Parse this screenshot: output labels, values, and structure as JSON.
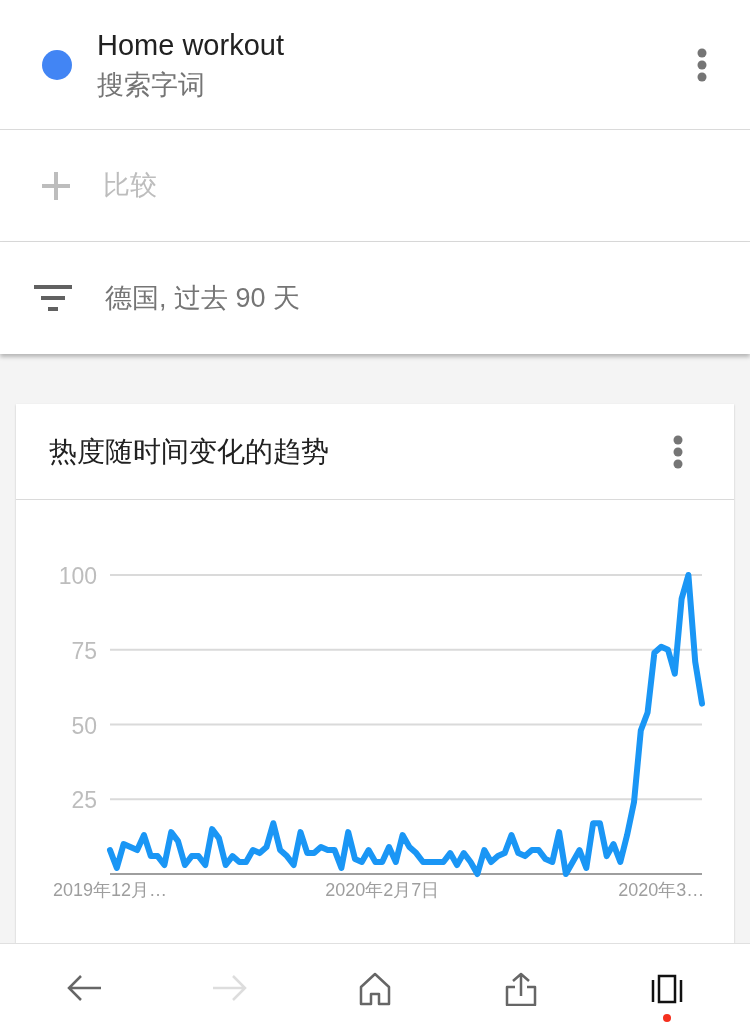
{
  "search_term": {
    "name": "Home workout",
    "subtitle": "搜索字词",
    "color": "#4285f4"
  },
  "compare": {
    "label": "比较"
  },
  "filter": {
    "label": "德国, 过去 90 天"
  },
  "card": {
    "title": "热度随时间变化的趋势",
    "chart_data": {
      "type": "line",
      "grid": true,
      "ylim": [
        0,
        100
      ],
      "yticks": [
        25,
        50,
        75,
        100
      ],
      "categories": [
        "2019年12月…",
        null,
        null,
        null,
        null,
        null,
        null,
        null,
        null,
        null,
        null,
        null,
        null,
        null,
        null,
        null,
        null,
        null,
        null,
        null,
        null,
        null,
        null,
        null,
        null,
        null,
        null,
        null,
        null,
        null,
        null,
        null,
        null,
        null,
        null,
        null,
        null,
        null,
        null,
        null,
        "2020年2月7日",
        null,
        null,
        null,
        null,
        null,
        null,
        null,
        null,
        null,
        null,
        null,
        null,
        null,
        null,
        null,
        null,
        null,
        null,
        null,
        null,
        null,
        null,
        null,
        null,
        null,
        null,
        null,
        null,
        null,
        null,
        null,
        null,
        null,
        null,
        null,
        null,
        null,
        null,
        null,
        null,
        "2020年3…",
        null,
        null,
        null,
        null,
        null,
        null
      ],
      "series": [
        {
          "color": "#1a96f5",
          "values": [
            8,
            2,
            10,
            9,
            8,
            13,
            6,
            6,
            3,
            14,
            11,
            3,
            6,
            6,
            3,
            15,
            12,
            3,
            6,
            4,
            4,
            8,
            7,
            9,
            17,
            8,
            6,
            3,
            14,
            7,
            7,
            9,
            8,
            8,
            2,
            14,
            5,
            4,
            8,
            4,
            4,
            9,
            4,
            13,
            9,
            7,
            4,
            4,
            4,
            4,
            7,
            3,
            7,
            4,
            0,
            8,
            4,
            6,
            7,
            13,
            7,
            6,
            8,
            8,
            5,
            4,
            14,
            0,
            4,
            8,
            2,
            17,
            17,
            6,
            10,
            4,
            13,
            24,
            48,
            54,
            74,
            76,
            75,
            67,
            92,
            100,
            71,
            57
          ]
        }
      ]
    }
  },
  "nav": [
    {
      "kind": "back",
      "disabled": false,
      "notification": false
    },
    {
      "kind": "forward",
      "disabled": true,
      "notification": false
    },
    {
      "kind": "home",
      "disabled": false,
      "notification": false
    },
    {
      "kind": "share",
      "disabled": false,
      "notification": false
    },
    {
      "kind": "tabs",
      "disabled": false,
      "notification": true
    }
  ]
}
